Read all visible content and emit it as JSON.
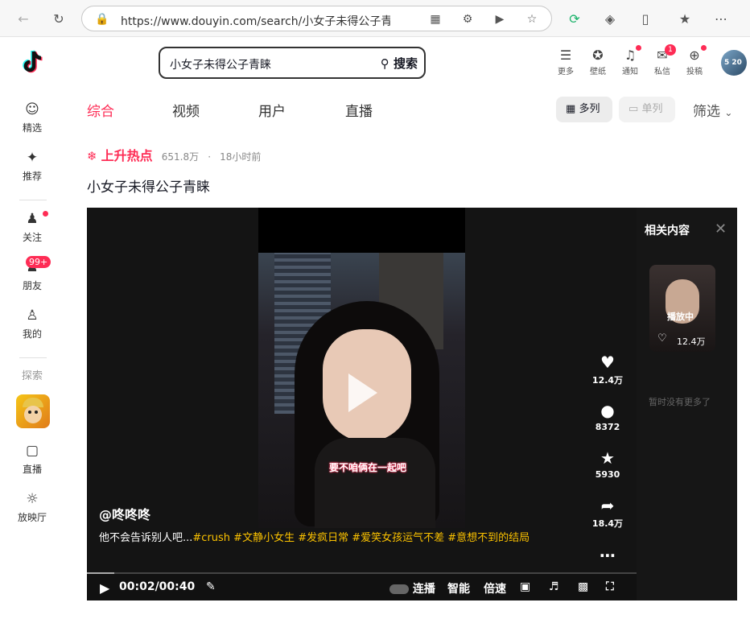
{
  "browser": {
    "url": "https://www.douyin.com/search/小女子未得公子青睐?aid..."
  },
  "sidebar": {
    "items": [
      {
        "label": "精选"
      },
      {
        "label": "推荐"
      },
      {
        "label": "关注"
      },
      {
        "label": "朋友",
        "badge": "99+"
      },
      {
        "label": "我的"
      },
      {
        "label": "探索"
      },
      {
        "label": "直播"
      },
      {
        "label": "放映厅"
      }
    ]
  },
  "search": {
    "query": "小女子未得公子青睐",
    "button": "搜索"
  },
  "topbar": {
    "items": [
      {
        "label": "更多"
      },
      {
        "label": "壁纸"
      },
      {
        "label": "通知"
      },
      {
        "label": "私信",
        "badge": "1"
      },
      {
        "label": "投稿"
      }
    ],
    "avatar_text": "5 20"
  },
  "tabs": {
    "items": [
      "综合",
      "视频",
      "用户",
      "直播"
    ],
    "view_multi": "多列",
    "view_single": "单列",
    "filter": "筛选"
  },
  "result": {
    "hot_label": "上升热点",
    "hot_count": "651.8万",
    "separator": "·",
    "time": "18小时前",
    "title": "小女子未得公子青睐"
  },
  "video": {
    "subtitle": "要不咱俩在一起吧",
    "author": "@咚咚咚",
    "desc_plain": "他不会告诉别人吧...",
    "tags": "#crush #文静小女生 #发疯日常 #爱笑女孩运气不差 #意想不到的结局",
    "likes": "12.4万",
    "comments": "8372",
    "favorites": "5930",
    "shares": "18.4万",
    "time": "00:02/00:40",
    "ctrl_autoplay": "连播",
    "ctrl_smart": "智能",
    "ctrl_speed": "倍速"
  },
  "related": {
    "title": "相关内容",
    "playing": "播放中",
    "likes": "12.4万",
    "empty": "暂时没有更多了"
  },
  "colors": {
    "accent": "#fe2c55",
    "hot": "#fe2c55",
    "tag": "#fac100"
  }
}
